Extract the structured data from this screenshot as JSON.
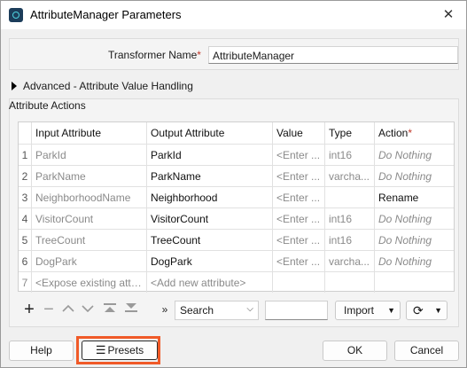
{
  "window": {
    "title": "AttributeManager Parameters",
    "close_glyph": "✕"
  },
  "transformer": {
    "label": "Transformer Name",
    "required_mark": "*",
    "value": "AttributeManager"
  },
  "advanced": {
    "label": "Advanced - Attribute Value Handling"
  },
  "attribute_actions": {
    "title": "Attribute Actions",
    "headers": {
      "input": "Input Attribute",
      "output": "Output Attribute",
      "value": "Value",
      "type": "Type",
      "action": "Action",
      "action_required": "*"
    },
    "rows": [
      {
        "num": "1",
        "input": "ParkId",
        "output": "ParkId",
        "value": "<Enter ...",
        "type": "int16",
        "action": "Do Nothing"
      },
      {
        "num": "2",
        "input": "ParkName",
        "output": "ParkName",
        "value": "<Enter ...",
        "type": "varcha...",
        "action": "Do Nothing"
      },
      {
        "num": "3",
        "input": "NeighborhoodName",
        "output": "Neighborhood",
        "value": "<Enter ...",
        "type": "",
        "action": "Rename"
      },
      {
        "num": "4",
        "input": "VisitorCount",
        "output": "VisitorCount",
        "value": "<Enter ...",
        "type": "int16",
        "action": "Do Nothing"
      },
      {
        "num": "5",
        "input": "TreeCount",
        "output": "TreeCount",
        "value": "<Enter ...",
        "type": "int16",
        "action": "Do Nothing"
      },
      {
        "num": "6",
        "input": "DogPark",
        "output": "DogPark",
        "value": "<Enter ...",
        "type": "varcha...",
        "action": "Do Nothing"
      },
      {
        "num": "7",
        "input": "<Expose existing attri...",
        "output": "<Add new attribute>",
        "value": "",
        "type": "",
        "action": ""
      }
    ]
  },
  "toolbar": {
    "icons": [
      "plus-icon",
      "minus-icon",
      "move-up-icon",
      "move-down-icon",
      "move-top-icon",
      "move-bottom-icon",
      "double-chevron-right-icon"
    ],
    "search_select": "Search",
    "import_label": "Import"
  },
  "footer": {
    "help": "Help",
    "presets": "Presets",
    "ok": "OK",
    "cancel": "Cancel"
  },
  "colors": {
    "highlight": "#f05a28",
    "required": "#c0392b"
  }
}
